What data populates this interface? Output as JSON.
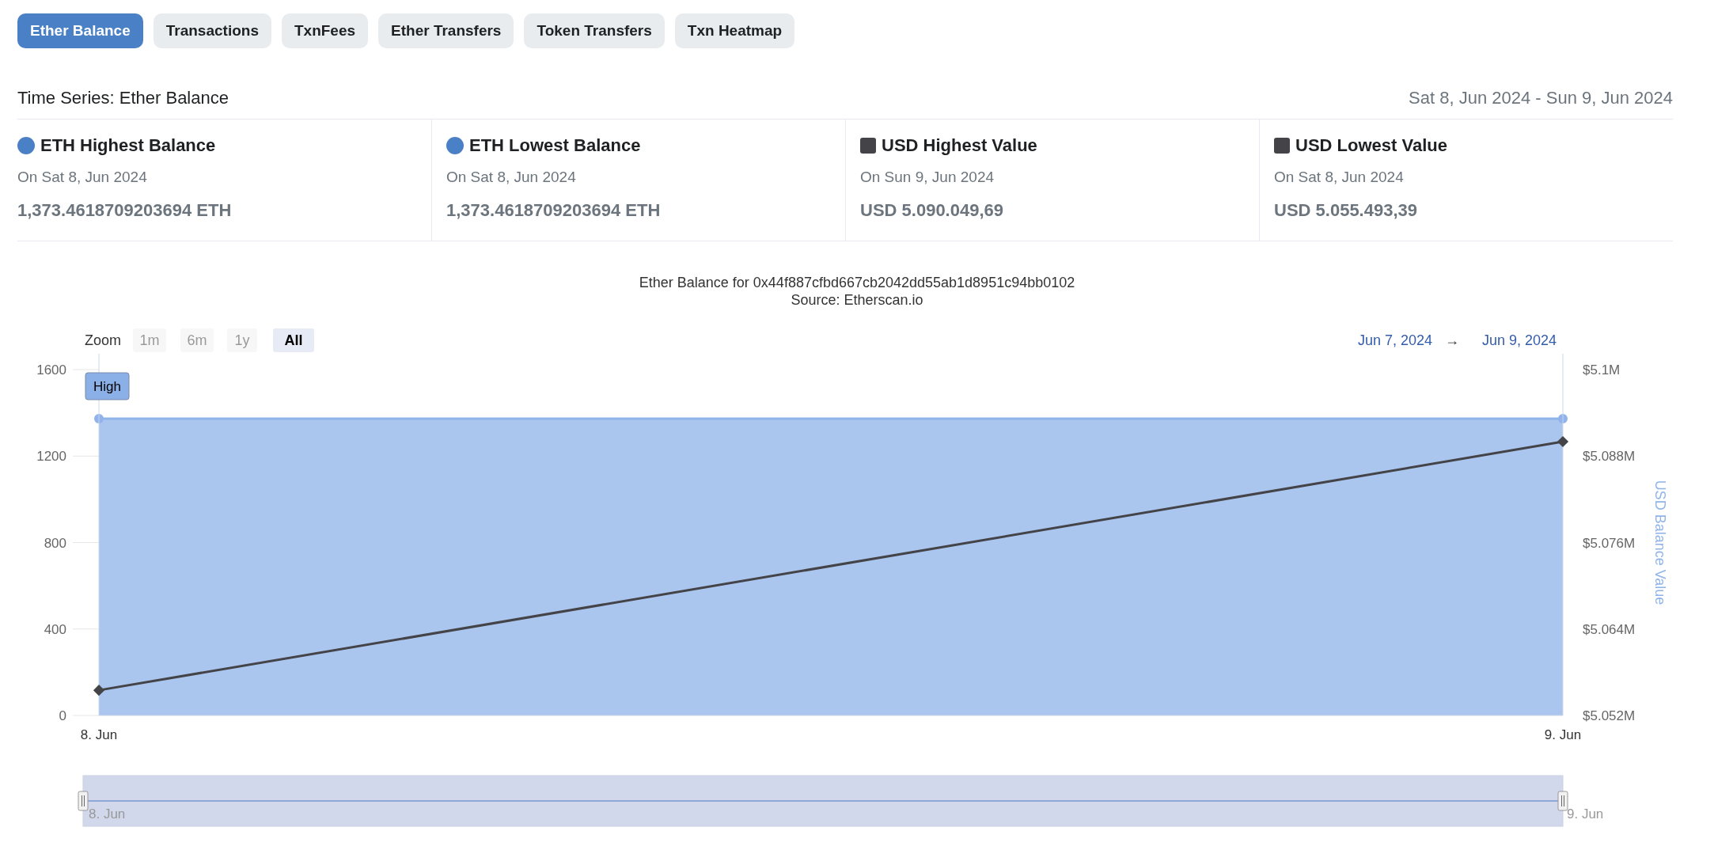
{
  "tabs": [
    {
      "label": "Ether Balance",
      "selected": true
    },
    {
      "label": "Transactions",
      "selected": false
    },
    {
      "label": "TxnFees",
      "selected": false
    },
    {
      "label": "Ether Transfers",
      "selected": false
    },
    {
      "label": "Token Transfers",
      "selected": false
    },
    {
      "label": "Txn Heatmap",
      "selected": false
    }
  ],
  "header": {
    "title": "Time Series: Ether Balance",
    "date_range": "Sat 8, Jun 2024 - Sun 9, Jun 2024"
  },
  "stats": [
    {
      "kind": "circle",
      "color": "#4a80c5",
      "label": "ETH Highest Balance",
      "date": "On Sat 8, Jun 2024",
      "value": "1,373.4618709203694 ETH"
    },
    {
      "kind": "circle",
      "color": "#4a80c5",
      "label": "ETH Lowest Balance",
      "date": "On Sat 8, Jun 2024",
      "value": "1,373.4618709203694 ETH"
    },
    {
      "kind": "square",
      "color": "#434348",
      "label": "USD Highest Value",
      "date": "On Sun 9, Jun 2024",
      "value": "USD 5.090.049,69"
    },
    {
      "kind": "square",
      "color": "#434348",
      "label": "USD Lowest Value",
      "date": "On Sat 8, Jun 2024",
      "value": "USD 5.055.493,39"
    }
  ],
  "chart": {
    "title": "Ether Balance for 0x44f887cfbd667cb2042dd55ab1d8951c94bb0102",
    "subtitle": "Source: Etherscan.io",
    "zoom": {
      "label": "Zoom",
      "buttons": [
        {
          "label": "1m",
          "selected": false,
          "disabled": true
        },
        {
          "label": "6m",
          "selected": false,
          "disabled": true
        },
        {
          "label": "1y",
          "selected": false,
          "disabled": true
        },
        {
          "label": "All",
          "selected": true,
          "disabled": false
        }
      ]
    },
    "range": {
      "from": "Jun 7, 2024",
      "arrow": "→",
      "to": "Jun 9, 2024"
    },
    "navigator": {
      "labels": [
        "8. Jun",
        "9. Jun"
      ]
    },
    "chart_data": {
      "type": "area",
      "categories": [
        "8. Jun",
        "9. Jun"
      ],
      "values": [
        1373,
        1373
      ],
      "marker": "circle",
      "ylim": [
        0,
        1600
      ],
      "yticks": [
        0,
        400,
        800,
        1200,
        1600
      ],
      "annotations": [
        {
          "text": "High"
        }
      ]
    },
    "usd_chart": {
      "chart_data": {
        "type": "line",
        "values": [
          5055500,
          5090000
        ],
        "marker": "diamond",
        "ylabel": "USD Balance Value",
        "ylim": [
          5052000,
          5100000
        ],
        "yticks": [
          {
            "value": 5052000,
            "label": "$5.052M"
          },
          {
            "value": 5064000,
            "label": "$5.064M"
          },
          {
            "value": 5076000,
            "label": "$5.076M"
          },
          {
            "value": 5088000,
            "label": "$5.088M"
          },
          {
            "value": 5100000,
            "label": "$5.1M"
          }
        ]
      }
    }
  }
}
